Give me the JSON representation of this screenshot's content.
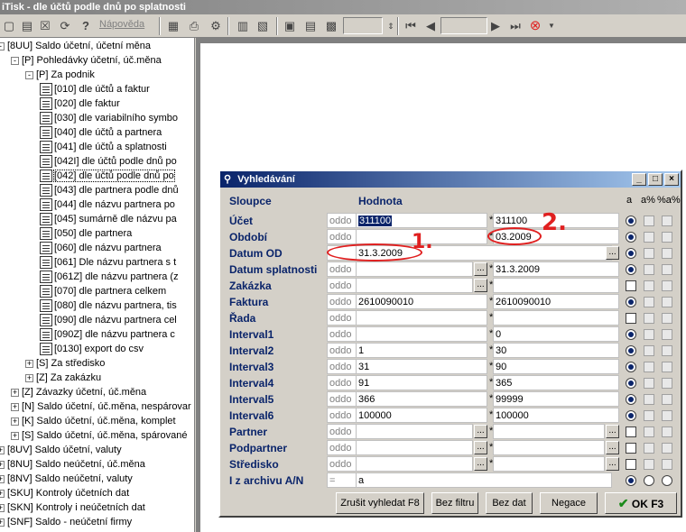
{
  "window": {
    "title": "iTisk - dle účtů podle dnů po splatnosti"
  },
  "toolbar": {
    "help_label": "Nápověda"
  },
  "tree": [
    {
      "text": "[8UU] Saldo účetní, účetní měna",
      "exp": "-",
      "lvl": 0
    },
    {
      "text": "[P] Pohledávky účetní, úč.měna",
      "exp": "-",
      "lvl": 1
    },
    {
      "text": "[P] Za podnik",
      "exp": "-",
      "lvl": 2
    },
    {
      "text": "[010] dle účtů a faktur",
      "lvl": 3
    },
    {
      "text": "[020] dle faktur",
      "lvl": 3
    },
    {
      "text": "[030] dle variabilního symbo",
      "lvl": 3
    },
    {
      "text": "[040] dle účtů a partnera",
      "lvl": 3
    },
    {
      "text": "[041] dle účtů a splatnosti",
      "lvl": 3
    },
    {
      "text": "[042I] dle účtů podle dnů po",
      "lvl": 3
    },
    {
      "text": "[042] dle účtů podle dnů po",
      "lvl": 3,
      "sel": true
    },
    {
      "text": "[043] dle partnera podle dnů",
      "lvl": 3
    },
    {
      "text": "[044] dle názvu partnera po",
      "lvl": 3
    },
    {
      "text": "[045] sumárně dle názvu pa",
      "lvl": 3
    },
    {
      "text": "[050] dle partnera",
      "lvl": 3
    },
    {
      "text": "[060] dle názvu partnera",
      "lvl": 3
    },
    {
      "text": "[061] Dle názvu partnera s t",
      "lvl": 3
    },
    {
      "text": "[061Z] dle názvu partnera (z",
      "lvl": 3
    },
    {
      "text": "[070] dle partnera celkem",
      "lvl": 3
    },
    {
      "text": "[080] dle názvu partnera, tis",
      "lvl": 3
    },
    {
      "text": "[090] dle názvu partnera cel",
      "lvl": 3
    },
    {
      "text": "[090Z] dle názvu partnera c",
      "lvl": 3
    },
    {
      "text": "[0130] export do csv",
      "lvl": 3
    },
    {
      "text": "[S] Za středisko",
      "exp": "+",
      "lvl": 2
    },
    {
      "text": "[Z] Za zakázku",
      "exp": "+",
      "lvl": 2
    },
    {
      "text": "[Z] Závazky účetní, úč.měna",
      "exp": "+",
      "lvl": 1
    },
    {
      "text": "[N] Saldo účetní, úč.měna, nespárovar",
      "exp": "+",
      "lvl": 1
    },
    {
      "text": "[K] Saldo účetní, úč.měna, komplet",
      "exp": "+",
      "lvl": 1
    },
    {
      "text": "[S] Saldo účetní, úč.měna, spárované",
      "exp": "+",
      "lvl": 1
    },
    {
      "text": "[8UV] Saldo účetní, valuty",
      "exp": "+",
      "lvl": 0
    },
    {
      "text": "[8NU] Saldo neúčetní, úč.měna",
      "exp": "+",
      "lvl": 0
    },
    {
      "text": "[8NV] Saldo neúčetní, valuty",
      "exp": "+",
      "lvl": 0
    },
    {
      "text": "[SKU] Kontroly účetních dat",
      "exp": "+",
      "lvl": 0
    },
    {
      "text": "[SKN] Kontroly i neúčetních dat",
      "exp": "+",
      "lvl": 0
    },
    {
      "text": "[SNF] Saldo - neúčetní firmy",
      "exp": "+",
      "lvl": 0
    }
  ],
  "dialog": {
    "title": "Vyhledávání",
    "col_sloupce": "Sloupce",
    "col_hodnota": "Hodnota",
    "col_a": "a",
    "col_ap": "a%",
    "col_pap": "%a%",
    "rows": [
      {
        "label": "Účet",
        "op": "oddo",
        "v1": "311100",
        "v2": "311100",
        "hl": true,
        "star": "*",
        "mode": "radio"
      },
      {
        "label": "Období",
        "op": "oddo",
        "v1": "",
        "v2": "03.2009",
        "star": "*",
        "mode": "radio"
      },
      {
        "label": "Datum OD",
        "op": "",
        "v1": "31.3.2009",
        "v2": "",
        "star": "",
        "wide": true,
        "mode": "radio"
      },
      {
        "label": "Datum splatnosti",
        "op": "oddo",
        "v1": "",
        "v2": "31.3.2009",
        "dots": true,
        "star": "*",
        "mode": "radio"
      },
      {
        "label": "Zakázka",
        "op": "oddo",
        "v1": "",
        "v2": "",
        "dots": true,
        "star": "*",
        "mode": "box"
      },
      {
        "label": "Faktura",
        "op": "oddo",
        "v1": "2610090010",
        "v2": "2610090010",
        "star": "*",
        "mode": "radio"
      },
      {
        "label": "Řada",
        "op": "oddo",
        "v1": "",
        "v2": "",
        "star": "*",
        "mode": "box"
      },
      {
        "label": "Interval1",
        "op": "oddo",
        "v1": "",
        "v2": "0",
        "star": "*",
        "mode": "radio"
      },
      {
        "label": "Interval2",
        "op": "oddo",
        "v1": "1",
        "v2": "30",
        "star": "*",
        "mode": "radio"
      },
      {
        "label": "Interval3",
        "op": "oddo",
        "v1": "31",
        "v2": "90",
        "star": "*",
        "mode": "radio"
      },
      {
        "label": "Interval4",
        "op": "oddo",
        "v1": "91",
        "v2": "365",
        "star": "*",
        "mode": "radio"
      },
      {
        "label": "Interval5",
        "op": "oddo",
        "v1": "366",
        "v2": "99999",
        "star": "*",
        "mode": "radio"
      },
      {
        "label": "Interval6",
        "op": "oddo",
        "v1": "100000",
        "v2": "100000",
        "star": "*",
        "mode": "radio"
      },
      {
        "label": "Partner",
        "op": "oddo",
        "v1": "",
        "v2": "",
        "dots": true,
        "dots2": true,
        "star": "*",
        "mode": "box"
      },
      {
        "label": "Podpartner",
        "op": "oddo",
        "v1": "",
        "v2": "",
        "dots": true,
        "dots2": true,
        "star": "*",
        "mode": "box"
      },
      {
        "label": "Středisko",
        "op": "oddo",
        "v1": "",
        "v2": "",
        "dots": true,
        "dots2": true,
        "star": "*",
        "mode": "box"
      },
      {
        "label": "I z archivu A/N",
        "op": "=",
        "v1": "a",
        "v2": "",
        "wide": true,
        "star": "",
        "mode": "radio3"
      }
    ],
    "buttons": {
      "cancel": "Zrušit vyhledat F8",
      "no_filter": "Bez filtru",
      "no_data": "Bez dat",
      "negate": "Negace",
      "ok": "OK F3"
    }
  },
  "annotations": {
    "mark1": "1.",
    "mark2": "2."
  },
  "colors": {
    "label_blue": "#0a246a",
    "title_blue": "#0a246a",
    "annotation_red": "#e02020"
  }
}
